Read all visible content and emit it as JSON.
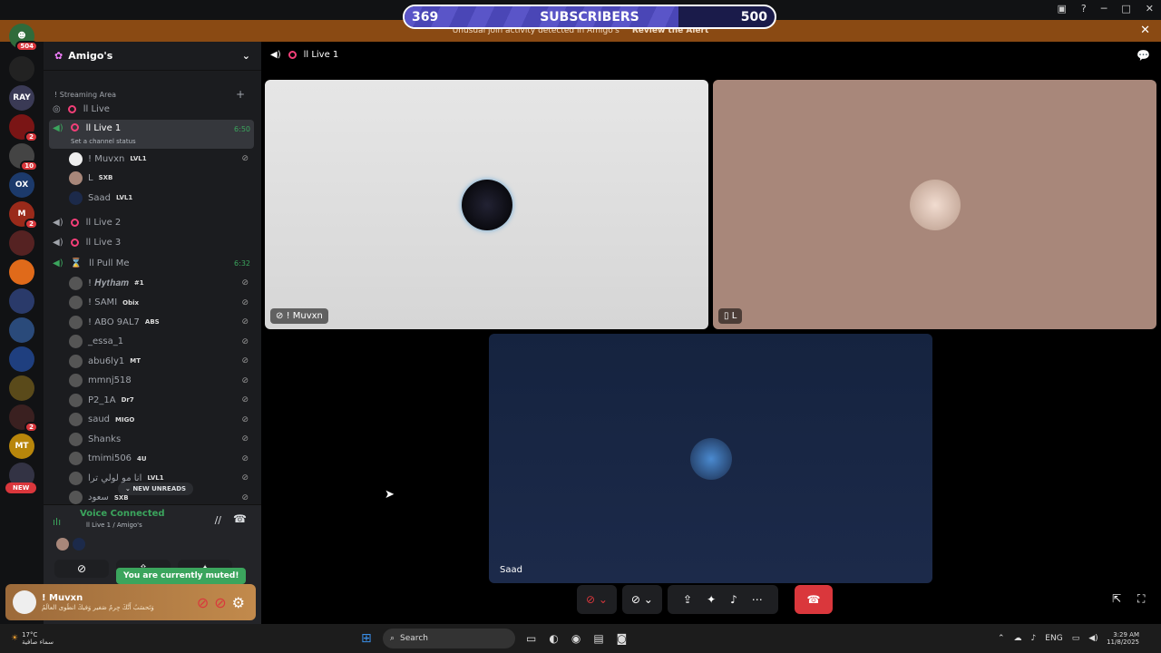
{
  "subscribers": {
    "current": "369",
    "label": "SUBSCRIBERS",
    "goal": "500",
    "progress": 0.74
  },
  "banner": {
    "text": "Unusual join activity detected in Amigo's",
    "action": "Review the Alert"
  },
  "rail": {
    "badges": [
      "504",
      "2",
      "10",
      "2",
      "2"
    ],
    "new_label": "NEW"
  },
  "sidebar": {
    "server_name": "Amigo's",
    "category": "! Streaming Area",
    "channels": [
      {
        "name": "اا Live"
      },
      {
        "name": "اا Live 1",
        "status": "Set a channel status",
        "time": "6:50"
      },
      {
        "name": "اا Live 2"
      },
      {
        "name": "اا Live 3"
      },
      {
        "name": "اا Pull Me",
        "time": "6:32"
      }
    ],
    "live1_users": [
      {
        "name": "! Muvxn",
        "tag": "LVL1"
      },
      {
        "name": "L",
        "tag": "SXB"
      },
      {
        "name": "Saad",
        "tag": "LVL1"
      }
    ],
    "pull_users": [
      {
        "name": "! 𝑯𝒚𝒕𝒉𝒂𝒎",
        "tag": "#1"
      },
      {
        "name": "! SAMI",
        "tag": "Obix"
      },
      {
        "name": "! ABO 9AL7",
        "tag": "ABS"
      },
      {
        "name": "_essa_1",
        "tag": ""
      },
      {
        "name": "abu6ly1",
        "tag": "MT"
      },
      {
        "name": "mmnj518",
        "tag": ""
      },
      {
        "name": "P2_1A",
        "tag": "Dr7"
      },
      {
        "name": "saud",
        "tag": "MIGO"
      },
      {
        "name": "Shanks",
        "tag": ""
      },
      {
        "name": "tmimi506",
        "tag": "4U"
      },
      {
        "name": "انا مو لولي ترا",
        "tag": "LVL1"
      },
      {
        "name": "سعود",
        "tag": "SXB"
      }
    ],
    "new_unreads": "NEW UNREADS"
  },
  "voice": {
    "title": "Voice Connected",
    "sub": "اا Live 1 / Amigo's",
    "muted_toast": "You are currently muted!"
  },
  "user": {
    "name": "! Muvxn",
    "status": "وَتَحسَبُ أَنَّكَ جِرمٌ صَغير وَفيكَ انطَوى العالَمُ"
  },
  "stage": {
    "channel": "اا Live 1",
    "tiles": [
      {
        "name": "! Muvxn"
      },
      {
        "name": "L"
      },
      {
        "name": "Saad"
      }
    ]
  },
  "taskbar": {
    "temp": "17°C",
    "weather": "سماء صافية",
    "search": "Search",
    "lang": "ENG",
    "time": "3:29 AM",
    "date": "11/8/2025"
  }
}
